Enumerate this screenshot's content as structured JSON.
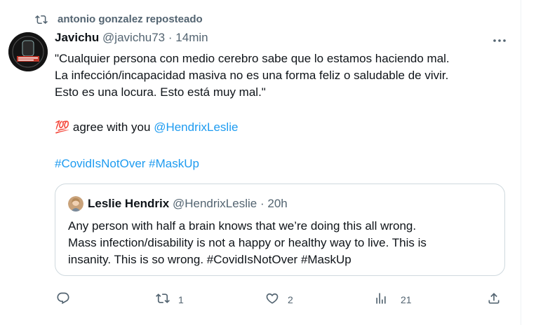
{
  "repost": {
    "label": "antonio gonzalez reposteado"
  },
  "tweet": {
    "name": "Javichu",
    "handle": "@javichu73",
    "separator": "·",
    "time": "14min",
    "line1": "\"Cualquier persona con medio cerebro sabe que lo estamos haciendo mal.",
    "line2": "La infección/incapacidad masiva no es una forma feliz o saludable de vivir.",
    "line3": "Esto es una locura. Esto está muy mal.\"",
    "emoji": "💯",
    "agree_text": " agree with you ",
    "mention": "@HendrixLeslie",
    "hashtag1": "#CovidIsNotOver",
    "hashtag2": "#MaskUp"
  },
  "quote": {
    "name": "Leslie Hendrix",
    "handle": "@HendrixLeslie",
    "separator": "·",
    "time": "20h",
    "line1": "Any person with half a brain knows that we’re doing this all wrong.",
    "line2": "Mass infection/disability is not a happy or healthy way to live. This is",
    "line3": "insanity. This is so wrong. #CovidIsNotOver #MaskUp"
  },
  "actions": {
    "reply_count": "",
    "repost_count": "1",
    "like_count": "2",
    "views_count": "21"
  },
  "colors": {
    "accent": "#1d9bf0",
    "muted": "#536471",
    "text": "#0f1419",
    "border": "#cfd9de"
  },
  "icons": [
    "repost-icon",
    "more-icon",
    "reply-icon",
    "retweet-icon",
    "like-icon",
    "views-icon",
    "share-icon"
  ]
}
